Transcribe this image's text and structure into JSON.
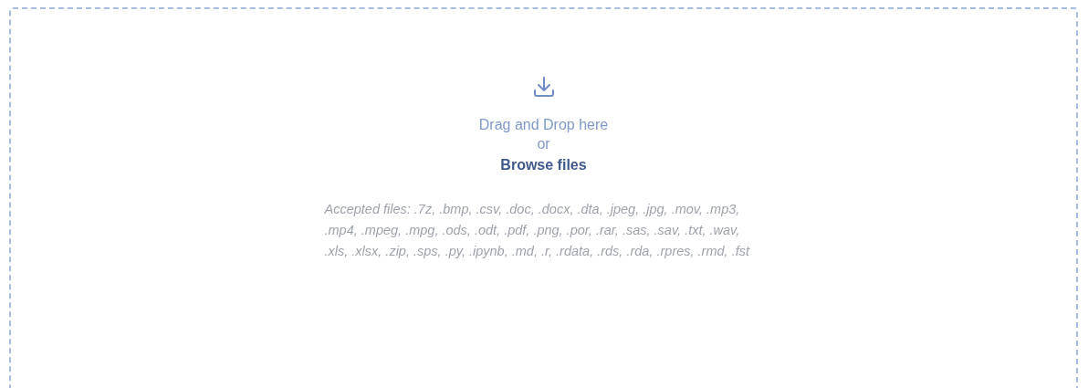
{
  "dropzone": {
    "prompt": "Drag and Drop here",
    "separator": "or",
    "browse_link": "Browse files",
    "accepted_files": "Accepted files: .7z, .bmp, .csv, .doc, .docx, .dta, .jpeg, .jpg, .mov, .mp3, .mp4, .mpeg, .mpg, .ods, .odt, .pdf, .png, .por, .rar, .sas, .sav, .txt, .wav, .xls, .xlsx, .zip, .sps, .py, .ipynb, .md, .r, .rdata, .rds, .rda, .rpres, .rmd, .fst"
  }
}
